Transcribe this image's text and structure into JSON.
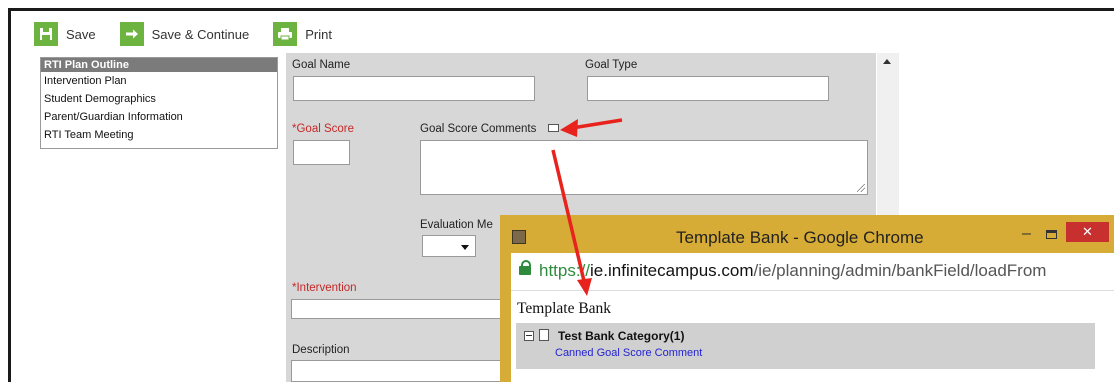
{
  "toolbar": {
    "save_label": "Save",
    "save_continue_label": "Save & Continue",
    "print_label": "Print"
  },
  "outline": {
    "items": [
      {
        "label": "RTI Plan Outline"
      },
      {
        "label": "Intervention Plan"
      },
      {
        "label": "Student Demographics"
      },
      {
        "label": "Parent/Guardian Information"
      },
      {
        "label": "RTI Team Meeting"
      }
    ]
  },
  "form": {
    "goal_name_label": "Goal Name",
    "goal_type_label": "Goal Type",
    "goal_score_label": "*Goal Score",
    "goal_score_comments_label": "Goal Score Comments",
    "evaluation_label": "Evaluation Me",
    "intervention_label": "*Intervention",
    "description_label": "Description"
  },
  "popup": {
    "window_title": "Template Bank - Google Chrome",
    "url_scheme": "https://",
    "url_host": "ie.infinitecampus.com",
    "url_path": "/ie/planning/admin/bankField/loadFrom",
    "heading": "Template Bank",
    "category": "Test Bank Category(1)",
    "comment": "Canned Goal Score Comment",
    "close_glyph": "✕",
    "minimize_glyph": "–"
  },
  "colors": {
    "accent_green": "#6cb33f",
    "required_red": "#c62828",
    "annotation_arrow": "#e8231d",
    "popup_frame": "#d6ab36",
    "link_blue": "#2323d3"
  }
}
